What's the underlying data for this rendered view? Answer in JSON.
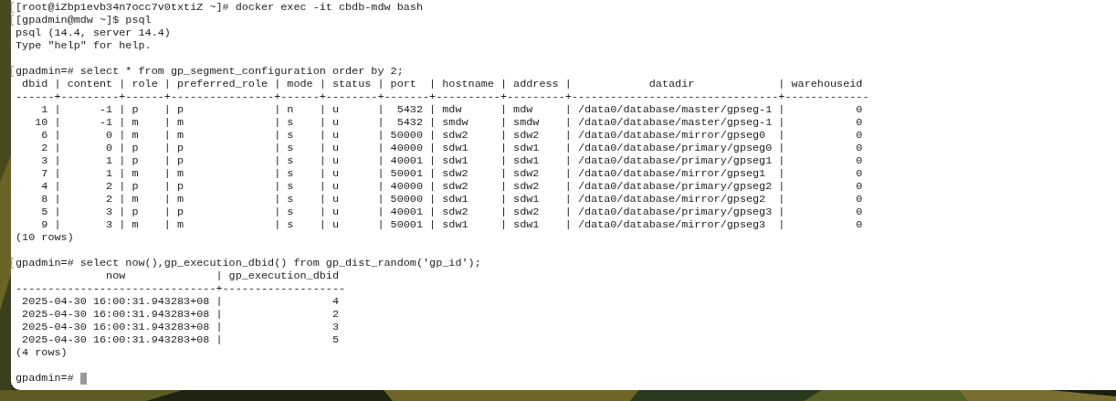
{
  "terminal": {
    "lines": [
      {
        "kind": "text",
        "marked": true,
        "text": "[root@iZbp1evb34n7occ7v0txtiZ ~]# docker exec -it cbdb-mdw bash"
      },
      {
        "kind": "text",
        "marked": true,
        "text": "[gpadmin@mdw ~]$ psql"
      },
      {
        "kind": "text",
        "marked": false,
        "text": "psql (14.4, server 14.4)"
      },
      {
        "kind": "text",
        "marked": false,
        "text": "Type \"help\" for help."
      },
      {
        "kind": "blank"
      },
      {
        "kind": "text",
        "marked": true,
        "text": "gpadmin=# select * from gp_segment_configuration order by 2;"
      },
      {
        "kind": "text",
        "marked": false,
        "text": " dbid | content | role | preferred_role | mode | status | port  | hostname | address |            datadir             | warehouseid"
      },
      {
        "kind": "text",
        "marked": false,
        "text": "------+---------+------+----------------+------+--------+-------+----------+---------+--------------------------------+-------------"
      },
      {
        "kind": "text",
        "marked": false,
        "text": "    1 |      -1 | p    | p              | n    | u      |  5432 | mdw      | mdw     | /data0/database/master/gpseg-1 |           0"
      },
      {
        "kind": "text",
        "marked": false,
        "text": "   10 |      -1 | m    | m              | s    | u      |  5432 | smdw     | smdw    | /data0/database/master/gpseg-1 |           0"
      },
      {
        "kind": "text",
        "marked": false,
        "text": "    6 |       0 | m    | m              | s    | u      | 50000 | sdw2     | sdw2    | /data0/database/mirror/gpseg0  |           0"
      },
      {
        "kind": "text",
        "marked": false,
        "text": "    2 |       0 | p    | p              | s    | u      | 40000 | sdw1     | sdw1    | /data0/database/primary/gpseg0 |           0"
      },
      {
        "kind": "text",
        "marked": false,
        "text": "    3 |       1 | p    | p              | s    | u      | 40001 | sdw1     | sdw1    | /data0/database/primary/gpseg1 |           0"
      },
      {
        "kind": "text",
        "marked": false,
        "text": "    7 |       1 | m    | m              | s    | u      | 50001 | sdw2     | sdw2    | /data0/database/mirror/gpseg1  |           0"
      },
      {
        "kind": "text",
        "marked": false,
        "text": "    4 |       2 | p    | p              | s    | u      | 40000 | sdw2     | sdw2    | /data0/database/primary/gpseg2 |           0"
      },
      {
        "kind": "text",
        "marked": false,
        "text": "    8 |       2 | m    | m              | s    | u      | 50000 | sdw1     | sdw1    | /data0/database/mirror/gpseg2  |           0"
      },
      {
        "kind": "text",
        "marked": false,
        "text": "    5 |       3 | p    | p              | s    | u      | 40001 | sdw2     | sdw2    | /data0/database/primary/gpseg3 |           0"
      },
      {
        "kind": "text",
        "marked": false,
        "text": "    9 |       3 | m    | m              | s    | u      | 50001 | sdw1     | sdw1    | /data0/database/mirror/gpseg3  |           0"
      },
      {
        "kind": "text",
        "marked": false,
        "text": "(10 rows)"
      },
      {
        "kind": "blank"
      },
      {
        "kind": "text",
        "marked": true,
        "text": "gpadmin=# select now(),gp_execution_dbid() from gp_dist_random('gp_id');"
      },
      {
        "kind": "text",
        "marked": false,
        "text": "              now              | gp_execution_dbid"
      },
      {
        "kind": "text",
        "marked": false,
        "text": "-------------------------------+-------------------"
      },
      {
        "kind": "text",
        "marked": false,
        "text": " 2025-04-30 16:00:31.943283+08 |                 4"
      },
      {
        "kind": "text",
        "marked": false,
        "text": " 2025-04-30 16:00:31.943283+08 |                 2"
      },
      {
        "kind": "text",
        "marked": false,
        "text": " 2025-04-30 16:00:31.943283+08 |                 3"
      },
      {
        "kind": "text",
        "marked": false,
        "text": " 2025-04-30 16:00:31.943283+08 |                 5"
      },
      {
        "kind": "text",
        "marked": false,
        "text": "(4 rows)"
      },
      {
        "kind": "blank"
      },
      {
        "kind": "text",
        "marked": false,
        "cursor": true,
        "text": "gpadmin=# "
      }
    ]
  }
}
